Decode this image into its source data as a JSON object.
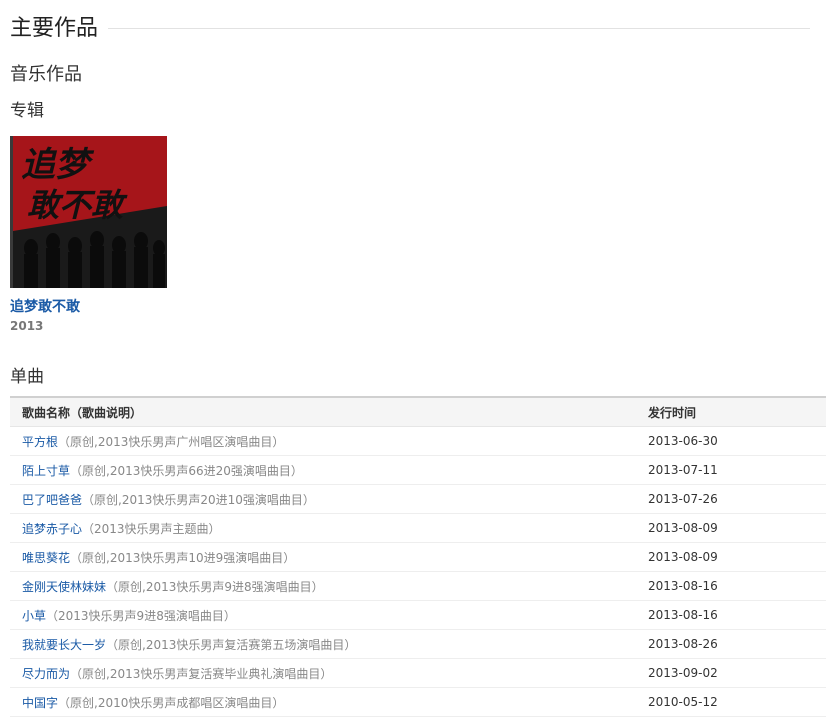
{
  "page": {
    "section_title": "主要作品",
    "music_title": "音乐作品",
    "album_heading": "专辑",
    "single_heading": "单曲"
  },
  "album": {
    "title": "追梦敢不敢",
    "year": "2013",
    "cover_text": [
      "追梦",
      "敢不敢"
    ]
  },
  "songs_table": {
    "col_name": "歌曲名称（歌曲说明）",
    "col_date": "发行时间",
    "rows": [
      {
        "name": "平方根",
        "desc": "（原创,2013快乐男声广州唱区演唱曲目）",
        "date": "2013-06-30"
      },
      {
        "name": "陌上寸草",
        "desc": "（原创,2013快乐男声66进20强演唱曲目）",
        "date": "2013-07-11"
      },
      {
        "name": "巴了吧爸爸",
        "desc": "（原创,2013快乐男声20进10强演唱曲目）",
        "date": "2013-07-26"
      },
      {
        "name": "追梦赤子心",
        "desc": "（2013快乐男声主题曲）",
        "date": "2013-08-09"
      },
      {
        "name": "唯思葵花",
        "desc": "（原创,2013快乐男声10进9强演唱曲目）",
        "date": "2013-08-09"
      },
      {
        "name": "金刚天使林妹妹",
        "desc": "（原创,2013快乐男声9进8强演唱曲目）",
        "date": "2013-08-16"
      },
      {
        "name": "小草",
        "desc": "（2013快乐男声9进8强演唱曲目）",
        "date": "2013-08-16"
      },
      {
        "name": "我就要长大一岁",
        "desc": "（原创,2013快乐男声复活赛第五场演唱曲目）",
        "date": "2013-08-26"
      },
      {
        "name": "尽力而为",
        "desc": "（原创,2013快乐男声复活赛毕业典礼演唱曲目）",
        "date": "2013-09-02"
      },
      {
        "name": "中国字",
        "desc": "（原创,2010快乐男声成都唱区演唱曲目）",
        "date": "2010-05-12"
      }
    ]
  },
  "colors": {
    "link": "#1a5aa6",
    "desc": "#888888",
    "cover_red": "#c0151b"
  }
}
